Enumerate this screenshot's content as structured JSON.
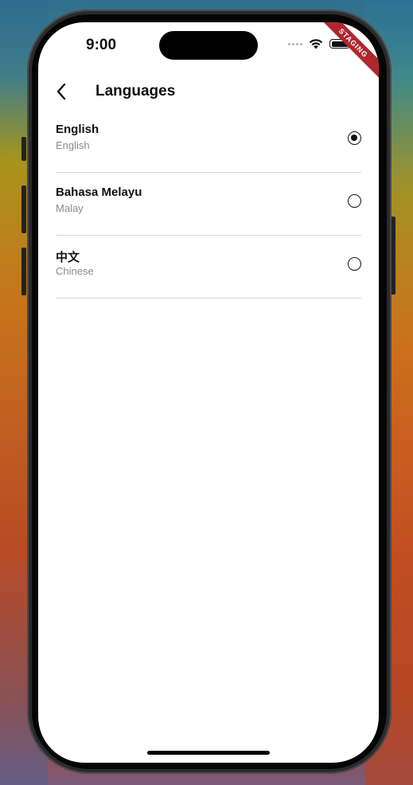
{
  "status_bar": {
    "time": "9:00",
    "icons": [
      "cellular-dots-icon",
      "wifi-icon",
      "battery-icon"
    ]
  },
  "ribbon": {
    "label": "STAGING",
    "color": "#b0272e"
  },
  "header": {
    "title": "Languages",
    "back_icon": "chevron-left-icon"
  },
  "languages": [
    {
      "name": "English",
      "subtitle": "English",
      "selected": true
    },
    {
      "name": "Bahasa Melayu",
      "subtitle": "Malay",
      "selected": false
    },
    {
      "name": "中文",
      "subtitle": "Chinese",
      "selected": false
    }
  ]
}
